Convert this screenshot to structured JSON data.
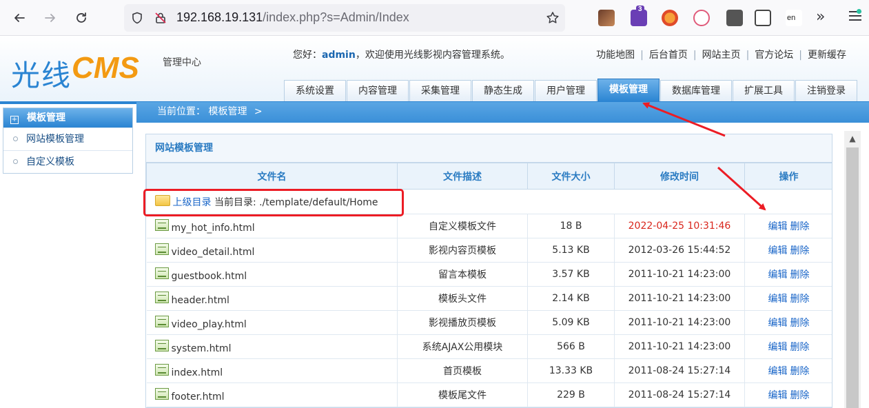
{
  "browser": {
    "url_host": "192.168.19.131",
    "url_path": "/index.php?s=Admin/Index",
    "ext_badge": "3",
    "ext_lang_label": "en"
  },
  "header": {
    "logo_cn": "光线",
    "logo_en": "CMS",
    "logo_sub": "管理中心",
    "welcome_prefix": "您好：",
    "username": "admin",
    "welcome_suffix": "，欢迎使用光线影视内容管理系统。",
    "top_links": [
      "功能地图",
      "后台首页",
      "网站主页",
      "官方论坛",
      "更新缓存"
    ],
    "nav_tabs": [
      "系统设置",
      "内容管理",
      "采集管理",
      "静态生成",
      "用户管理",
      "模板管理",
      "数据库管理",
      "扩展工具",
      "注销登录"
    ],
    "active_tab": "模板管理"
  },
  "sidebar": {
    "title": "模板管理",
    "items": [
      "网站模板管理",
      "自定义模板"
    ]
  },
  "breadcrumb": {
    "label": "当前位置：",
    "current": "模板管理",
    "separator": ">"
  },
  "panel": {
    "title": "网站模板管理",
    "columns": [
      "文件名",
      "文件描述",
      "文件大小",
      "修改时间",
      "操作"
    ],
    "up_link": "上级目录",
    "current_dir_label": "当前目录: ",
    "current_dir": "./template/default/Home",
    "edit_label": "编辑",
    "delete_label": "删除",
    "rows": [
      {
        "name": "my_hot_info.html",
        "desc": "自定义模板文件",
        "size": "18 B",
        "time": "2022-04-25 10:31:46"
      },
      {
        "name": "video_detail.html",
        "desc": "影视内容页模板",
        "size": "5.13 KB",
        "time": "2012-03-26 15:44:52"
      },
      {
        "name": "guestbook.html",
        "desc": "留言本模板",
        "size": "3.57 KB",
        "time": "2011-10-21 14:23:00"
      },
      {
        "name": "header.html",
        "desc": "模板头文件",
        "size": "2.14 KB",
        "time": "2011-10-21 14:23:00"
      },
      {
        "name": "video_play.html",
        "desc": "影视播放页模板",
        "size": "5.09 KB",
        "time": "2011-10-21 14:23:00"
      },
      {
        "name": "system.html",
        "desc": "系统AJAX公用模块",
        "size": "566 B",
        "time": "2011-10-21 14:23:00"
      },
      {
        "name": "index.html",
        "desc": "首页模板",
        "size": "13.33 KB",
        "time": "2011-08-24 15:27:14"
      },
      {
        "name": "footer.html",
        "desc": "模板尾文件",
        "size": "229 B",
        "time": "2011-08-24 15:27:14"
      }
    ]
  },
  "colors": {
    "accent_blue": "#2a84d2",
    "logo_orange": "#f39a12",
    "highlight_red": "#ec1c24",
    "recent_time_red": "#d9261c"
  }
}
